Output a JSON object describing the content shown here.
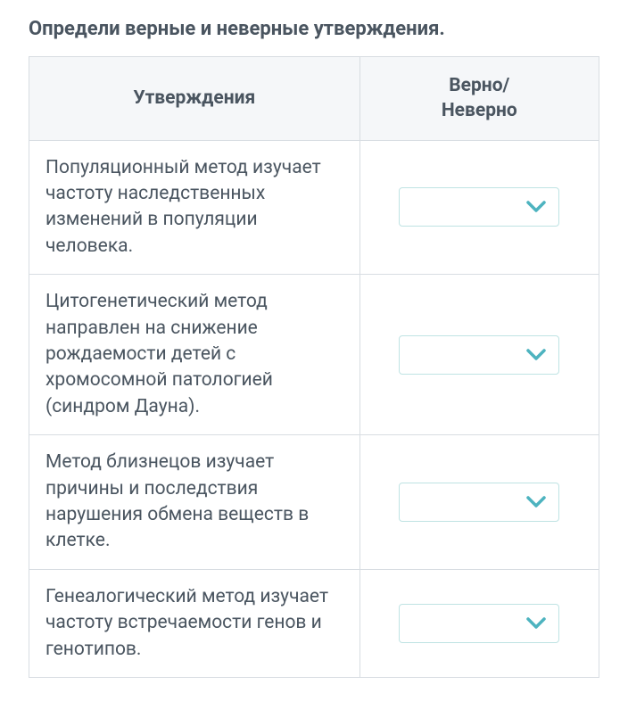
{
  "title": "Определи верные и неверные утверждения.",
  "headers": {
    "statement": "Утверждения",
    "answer": "Верно/\nНеверно"
  },
  "rows": [
    {
      "statement": "Популяционный метод изучает частоту наследственных изменений в популяции человека.",
      "selected": ""
    },
    {
      "statement": "Цитогенетический метод направлен на снижение рождаемости детей с хромосомной патологией (синдром Дауна).",
      "selected": ""
    },
    {
      "statement": "Метод близнецов изучает причины и последствия нарушения обмена веществ в клетке.",
      "selected": ""
    },
    {
      "statement": "Генеалогический метод изучает частоту встречаемости генов и генотипов.",
      "selected": ""
    }
  ],
  "colors": {
    "chevron": "#4db3bf"
  }
}
